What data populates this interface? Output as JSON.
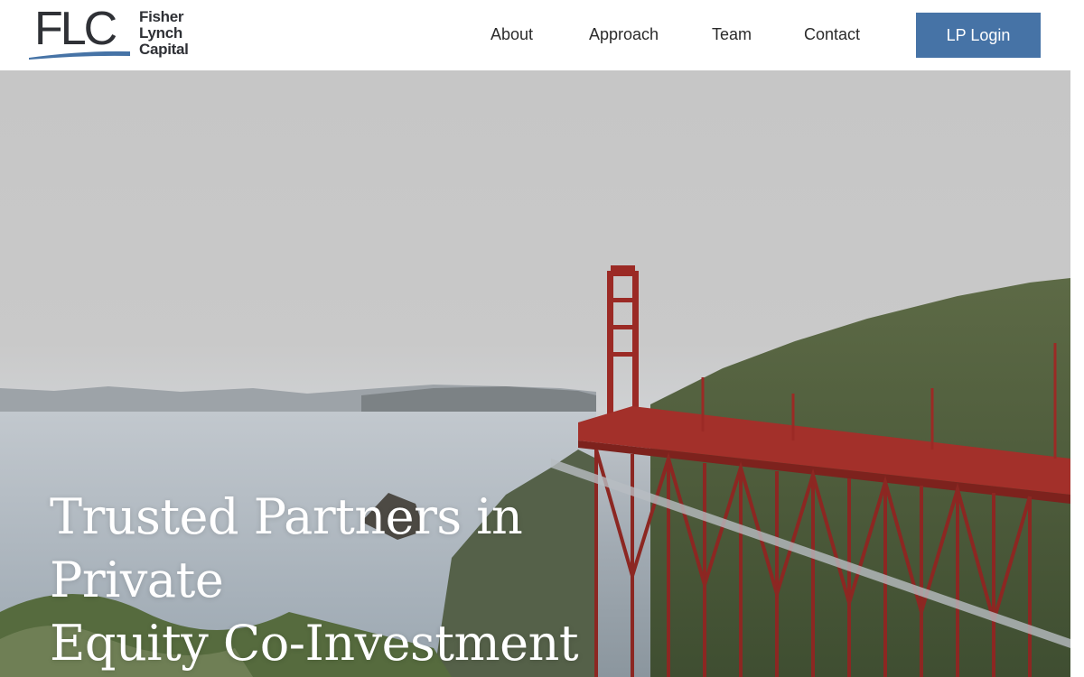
{
  "brand": {
    "mark": "FLC",
    "name_lines": [
      "Fisher",
      "Lynch",
      "Capital"
    ],
    "accent_color": "#4673a6"
  },
  "nav": {
    "items": [
      {
        "label": "About"
      },
      {
        "label": "Approach"
      },
      {
        "label": "Team"
      },
      {
        "label": "Contact"
      }
    ],
    "login_label": "LP Login"
  },
  "hero": {
    "headline_line1": "Trusted Partners in Private",
    "headline_line2": "Equity Co-Investment",
    "image_subject": "golden-gate-bridge-photo"
  }
}
